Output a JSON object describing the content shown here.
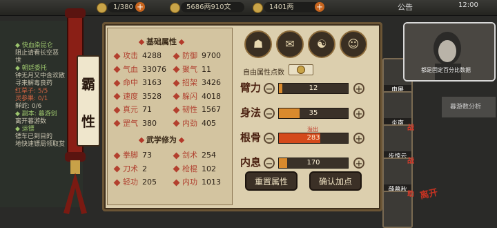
{
  "topbar": {
    "stamina": "1/380",
    "coins": "5686两910文",
    "gold": "1401两",
    "notice": "公告",
    "clock": "12:00"
  },
  "quests": [
    {
      "text": "◆ 快血染昆仑",
      "kind": "title"
    },
    {
      "text": "阻止请看长空恶",
      "kind": "desc"
    },
    {
      "text": "世",
      "kind": "desc"
    },
    {
      "text": "◆ 朝廷委托",
      "kind": "title"
    },
    {
      "text": "钟无月又中含欢散",
      "kind": "desc"
    },
    {
      "text": "寻来解毒良药",
      "kind": "desc"
    },
    {
      "text": "红草子: 5/5",
      "kind": "red"
    },
    {
      "text": "灵参果: 0/1",
      "kind": "red"
    },
    {
      "text": "鲜蛇: 0/6",
      "kind": "desc"
    },
    {
      "text": "◆ 副本: 暮游剑",
      "kind": "title"
    },
    {
      "text": "离开暮游数",
      "kind": "desc"
    },
    {
      "text": "◆ 运镖",
      "kind": "title"
    },
    {
      "text": "镖车已到目的",
      "kind": "desc"
    },
    {
      "text": "地快速镖局领取赏",
      "kind": "desc"
    }
  ],
  "character": {
    "name_chars": [
      "霸",
      "性"
    ]
  },
  "basic_title": "基础属性",
  "basic_stats": [
    {
      "label": "攻击",
      "value": "4288"
    },
    {
      "label": "防御",
      "value": "9700"
    },
    {
      "label": "气血",
      "value": "33076"
    },
    {
      "label": "聚气",
      "value": "11"
    },
    {
      "label": "命中",
      "value": "3163"
    },
    {
      "label": "招架",
      "value": "3426"
    },
    {
      "label": "速度",
      "value": "3528"
    },
    {
      "label": "躲闪",
      "value": "4018"
    },
    {
      "label": "真元",
      "value": "71"
    },
    {
      "label": "韧性",
      "value": "1567"
    },
    {
      "label": "罡气",
      "value": "380"
    },
    {
      "label": "内劲",
      "value": "405"
    }
  ],
  "martial_title": "武学修为",
  "martial_stats": [
    {
      "label": "拳脚",
      "value": "73"
    },
    {
      "label": "剑术",
      "value": "254"
    },
    {
      "label": "刀术",
      "value": "2"
    },
    {
      "label": "枪棍",
      "value": "102"
    },
    {
      "label": "轻功",
      "value": "205"
    },
    {
      "label": "内功",
      "value": "1013"
    }
  ],
  "tools": [
    {
      "icon": "hat-icon",
      "glyph": "☗"
    },
    {
      "icon": "scroll-icon",
      "glyph": "✉"
    },
    {
      "icon": "taiji-icon",
      "glyph": "☯"
    },
    {
      "icon": "figure-icon",
      "glyph": "☺"
    }
  ],
  "free_points_label": "自由属性点数",
  "attributes": [
    {
      "label": "臂力",
      "value": "12",
      "fill": 0.05,
      "over": false,
      "note": ""
    },
    {
      "label": "身法",
      "value": "35",
      "fill": 0.3,
      "over": false,
      "note": ""
    },
    {
      "label": "根骨",
      "value": "283",
      "fill": 0.6,
      "over": true,
      "note": "溢出"
    },
    {
      "label": "内息",
      "value": "170",
      "fill": 0.12,
      "over": false,
      "note": ""
    }
  ],
  "buttons": {
    "reset": "重置属性",
    "confirm": "确认加点"
  },
  "party": [
    {
      "name": "申屠",
      "status": ""
    },
    {
      "name": "炎南",
      "status": ""
    },
    {
      "name": "步惊云",
      "status": "战"
    },
    {
      "name": "薛慕秋",
      "status": "战"
    },
    {
      "name": "",
      "status": "助"
    }
  ],
  "leave_label": "离开",
  "info_label": "暮游数分析",
  "video_caption": "都是固定百分比数据",
  "colors": {
    "accent": "#b0402f",
    "panel": "#dccfae",
    "bar": "#d98a2d",
    "overflow": "#d44a1c"
  }
}
